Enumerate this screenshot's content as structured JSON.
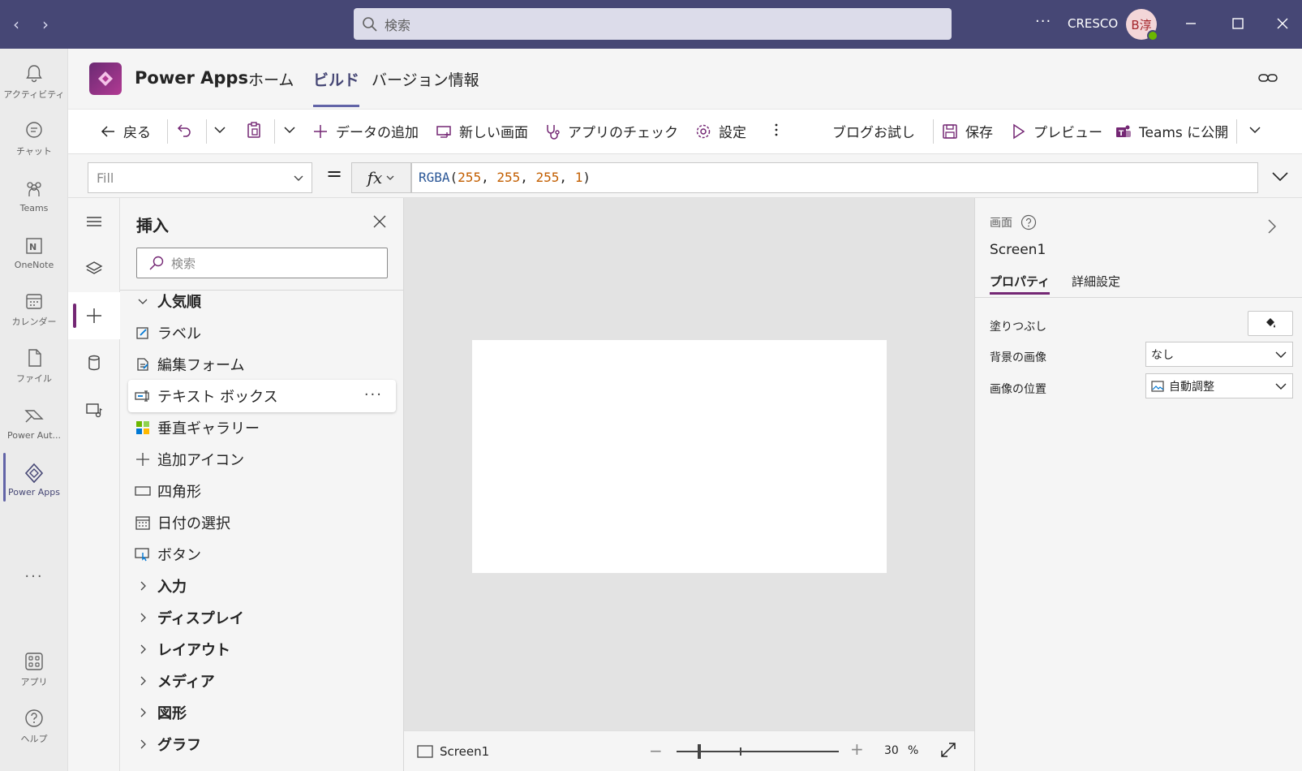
{
  "titlebar": {
    "search_placeholder": "検索",
    "org": "CRESCO",
    "avatar_initials": "B淳",
    "more": "···"
  },
  "rail": {
    "items": [
      {
        "label": "アクティビティ"
      },
      {
        "label": "チャット"
      },
      {
        "label": "Teams"
      },
      {
        "label": "OneNote"
      },
      {
        "label": "カレンダー"
      },
      {
        "label": "ファイル"
      },
      {
        "label": "Power Aut..."
      },
      {
        "label": "Power Apps"
      },
      {
        "label": "アプリ"
      },
      {
        "label": "ヘルプ"
      }
    ],
    "more": "···"
  },
  "appheader": {
    "app_name": "Power Apps",
    "tabs": [
      {
        "label": "ホーム"
      },
      {
        "label": "ビルド"
      },
      {
        "label": "バージョン情報"
      }
    ]
  },
  "commandbar": {
    "back": "戻る",
    "add_data": "データの追加",
    "new_screen": "新しい画面",
    "app_check": "アプリのチェック",
    "settings": "設定",
    "blog_trial": "ブログお試し",
    "save": "保存",
    "preview": "プレビュー",
    "publish": "Teams に公開"
  },
  "formulabar": {
    "property": "Fill",
    "equals": "=",
    "fx": "fx",
    "formula_fn": "RGBA",
    "formula_args": [
      "255",
      "255",
      "255",
      "1"
    ],
    "formula_open": "(",
    "formula_close": ")",
    "formula_sep": ", "
  },
  "insert_panel": {
    "title": "挿入",
    "search_placeholder": "検索",
    "popular_category": "人気順",
    "popular_items": [
      {
        "label": "ラベル"
      },
      {
        "label": "編集フォーム"
      },
      {
        "label": "テキスト ボックス"
      },
      {
        "label": "垂直ギャラリー"
      },
      {
        "label": "追加アイコン"
      },
      {
        "label": "四角形"
      },
      {
        "label": "日付の選択"
      },
      {
        "label": "ボタン"
      }
    ],
    "categories": [
      {
        "label": "入力"
      },
      {
        "label": "ディスプレイ"
      },
      {
        "label": "レイアウト"
      },
      {
        "label": "メディア"
      },
      {
        "label": "図形"
      },
      {
        "label": "グラフ"
      }
    ],
    "row_more": "···"
  },
  "canvas": {
    "screen_name": "Screen1",
    "zoom_value": "30",
    "zoom_unit": "%",
    "zoom_level": 0.3
  },
  "properties": {
    "type_label": "画面",
    "name": "Screen1",
    "tabs": [
      {
        "label": "プロパティ"
      },
      {
        "label": "詳細設定"
      }
    ],
    "fill_label": "塗りつぶし",
    "bg_image_label": "背景の画像",
    "bg_image_value": "なし",
    "image_position_label": "画像の位置",
    "image_position_value": "自動調整"
  },
  "colors": {
    "titlebar": "#464775",
    "accent": "#742774",
    "teams_accent": "#6264a7"
  }
}
